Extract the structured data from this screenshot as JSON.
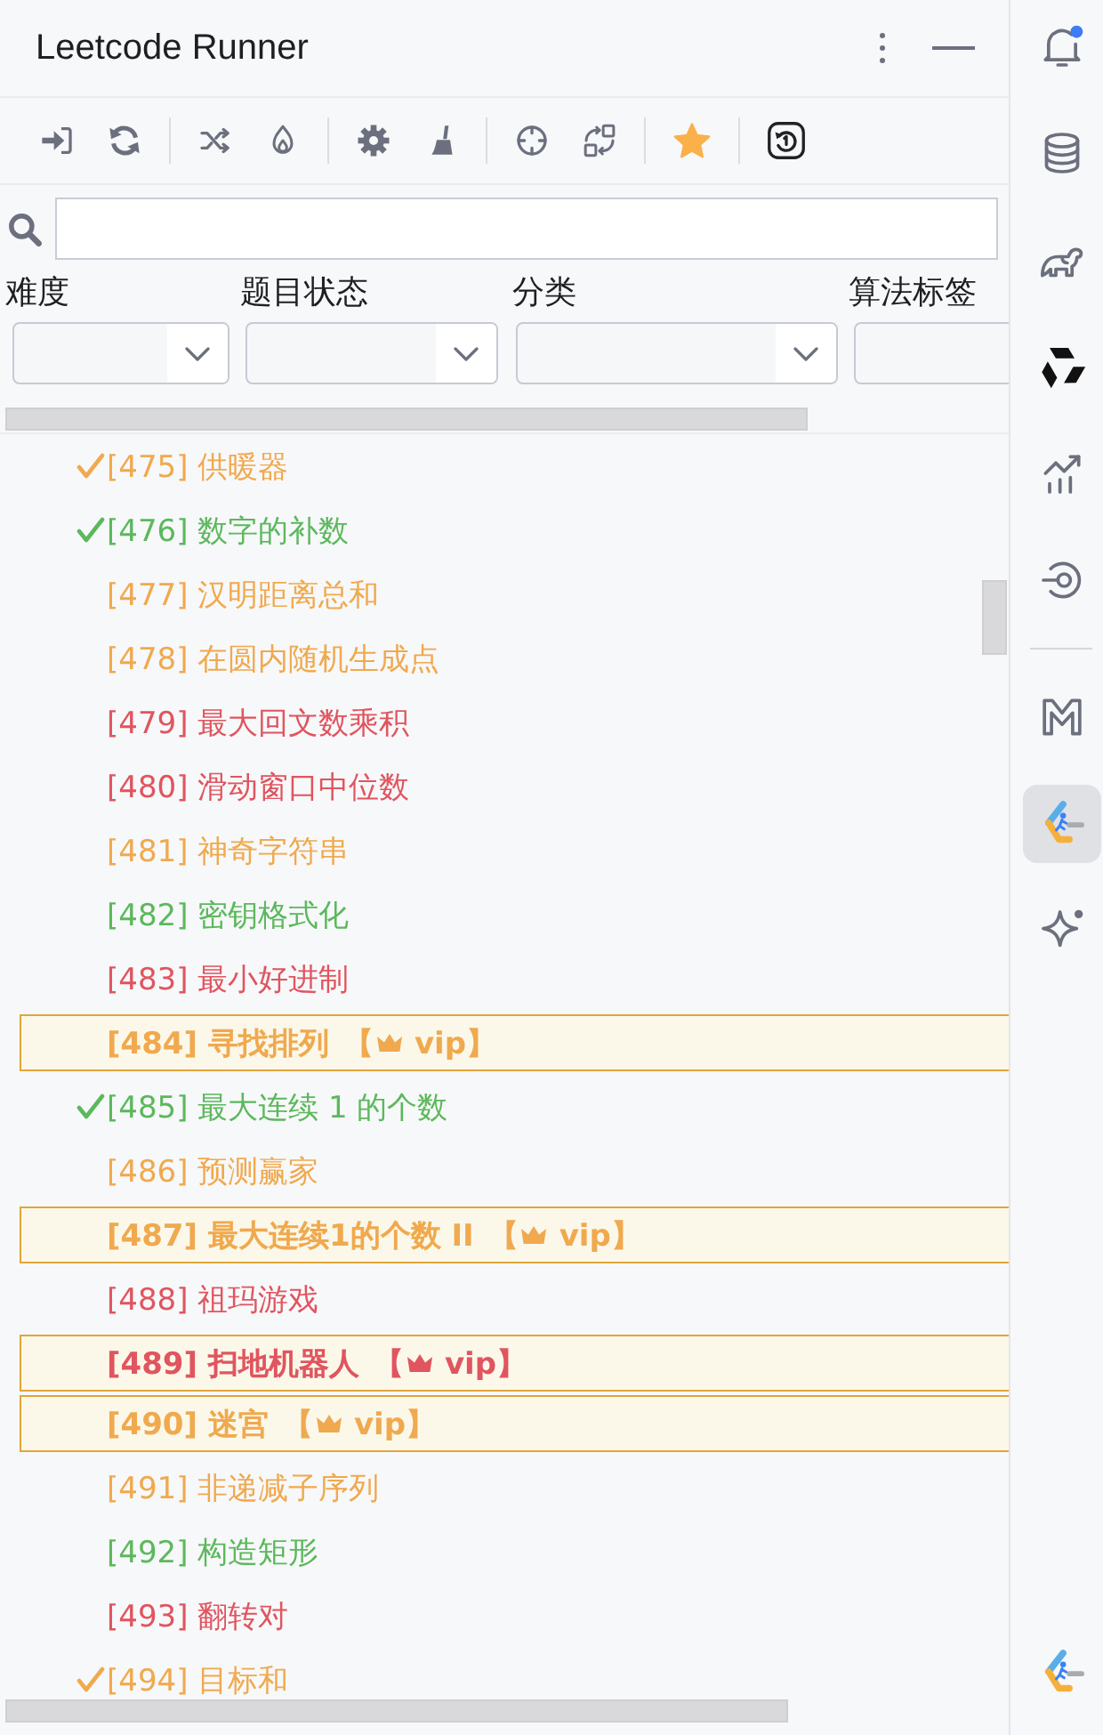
{
  "panel": {
    "title": "Leetcode Runner"
  },
  "filters": [
    {
      "label": "难度"
    },
    {
      "label": "题目状态"
    },
    {
      "label": "分类"
    },
    {
      "label": "算法标签"
    }
  ],
  "problems": [
    {
      "label": "[475] 供暖器",
      "color": "#f0a94e",
      "solved": true,
      "vip": false
    },
    {
      "label": "[476] 数字的补数",
      "color": "#5cb85c",
      "solved": true,
      "vip": false
    },
    {
      "label": "[477] 汉明距离总和",
      "color": "#f0a94e",
      "solved": false,
      "vip": false
    },
    {
      "label": "[478] 在圆内随机生成点",
      "color": "#f0a94e",
      "solved": false,
      "vip": false
    },
    {
      "label": "[479] 最大回文数乘积",
      "color": "#e0555f",
      "solved": false,
      "vip": false
    },
    {
      "label": "[480] 滑动窗口中位数",
      "color": "#e0555f",
      "solved": false,
      "vip": false
    },
    {
      "label": "[481] 神奇字符串",
      "color": "#f0a94e",
      "solved": false,
      "vip": false
    },
    {
      "label": "[482] 密钥格式化",
      "color": "#5cb85c",
      "solved": false,
      "vip": false
    },
    {
      "label": "[483] 最小好进制",
      "color": "#e0555f",
      "solved": false,
      "vip": false
    },
    {
      "label": "[484] 寻找排列",
      "color": "#f0a94e",
      "solved": false,
      "vip": true,
      "tag_open": "【",
      "tag_text": "vip】"
    },
    {
      "label": "[485] 最大连续 1 的个数",
      "color": "#5cb85c",
      "solved": true,
      "vip": false
    },
    {
      "label": "[486] 预测赢家",
      "color": "#f0a94e",
      "solved": false,
      "vip": false
    },
    {
      "label": "[487] 最大连续1的个数 II",
      "color": "#f0a94e",
      "solved": false,
      "vip": true,
      "tag_open": "【",
      "tag_text": "vip】"
    },
    {
      "label": "[488] 祖玛游戏",
      "color": "#e0555f",
      "solved": false,
      "vip": false
    },
    {
      "label": "[489] 扫地机器人",
      "color": "#e0555f",
      "solved": false,
      "vip": true,
      "tag_open": "【",
      "tag_text": "vip】"
    },
    {
      "label": "[490] 迷宫",
      "color": "#f0a94e",
      "solved": false,
      "vip": true,
      "tag_open": "【",
      "tag_text": "vip】"
    },
    {
      "label": "[491] 非递减子序列",
      "color": "#f0a94e",
      "solved": false,
      "vip": false
    },
    {
      "label": "[492] 构造矩形",
      "color": "#5cb85c",
      "solved": false,
      "vip": false
    },
    {
      "label": "[493] 翻转对",
      "color": "#e0555f",
      "solved": false,
      "vip": false
    },
    {
      "label": "[494] 目标和",
      "color": "#f0a94e",
      "solved": true,
      "vip": false
    }
  ],
  "tool_strip": {
    "top": [
      {
        "selected": false
      },
      {
        "selected": false
      },
      {
        "selected": false
      },
      {
        "selected": false
      },
      {
        "selected": false
      },
      {
        "selected": false
      },
      {
        "selected": false
      },
      {
        "selected": true
      },
      {
        "selected": false
      }
    ],
    "bottom": [
      {
        "selected": false
      }
    ]
  }
}
